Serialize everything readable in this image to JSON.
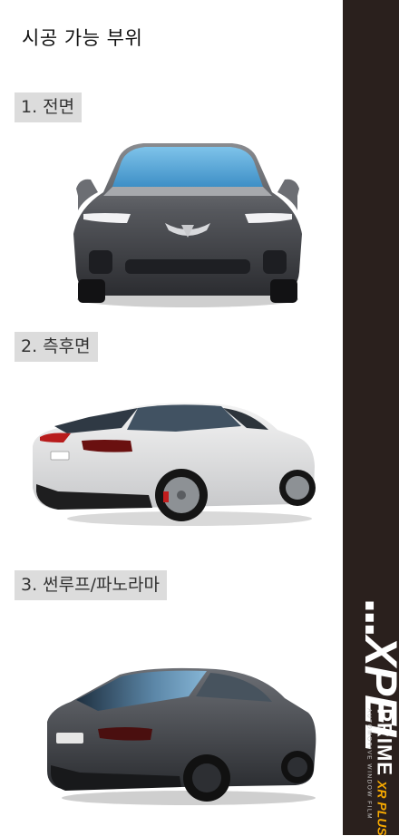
{
  "page": {
    "title": "시공 가능 부위"
  },
  "sections": [
    {
      "label": "1. 전면"
    },
    {
      "label": "2. 측후면"
    },
    {
      "label": "3. 썬루프/파노라마"
    }
  ],
  "brand": {
    "xpel": "XPEL",
    "product": "PRIME",
    "product_suffix": "XR PLUS",
    "tagline": "AUTOMOTIVE WINDOW FILM"
  },
  "images": {
    "front": "front-car-image",
    "side_rear": "side-rear-car-image",
    "sunroof": "panoramic-roof-car-image"
  },
  "colors": {
    "sidebar": "#2a201d",
    "accent": "#f5a800",
    "label_bg": "#dcdcdc"
  }
}
